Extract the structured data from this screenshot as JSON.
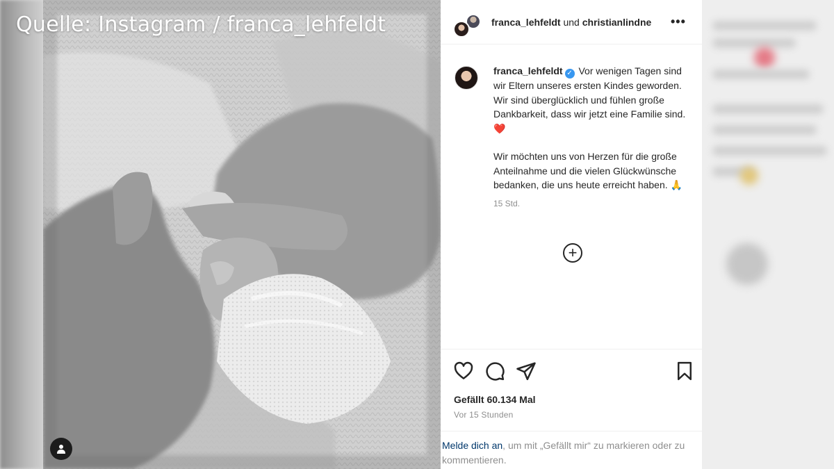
{
  "overlay": {
    "source_caption": "Quelle: Instagram / franca_lehfeldt"
  },
  "post": {
    "header": {
      "author": "franca_lehfeldt",
      "joiner": "und",
      "coauthor": "christianlindne"
    },
    "caption": {
      "username": "franca_lehfeldt",
      "verified": true,
      "paragraph1": "Vor wenigen Tagen sind wir Eltern unseres ersten Kindes geworden. Wir sind überglücklich und fühlen große Dankbarkeit, dass wir jetzt eine Familie sind.",
      "paragraph1_emoji": "❤️",
      "paragraph2": "Wir möchten uns von Herzen für die große Anteilnahme und die vielen Glückwünsche bedanken, die uns heute erreicht haben.",
      "paragraph2_emoji": "🙏",
      "time": "15 Std."
    },
    "likes": "Gefällt 60.134 Mal",
    "posted_ago": "Vor 15 Stunden",
    "login_prompt": {
      "link": "Melde dich an",
      "rest": ", um mit „Gefällt mir“ zu markieren oder zu kommentieren."
    }
  },
  "icons": {
    "more": "more-options-icon",
    "verified": "verified-badge-icon",
    "load_more": "add-circle-icon",
    "like": "heart-icon",
    "comment": "comment-icon",
    "share": "share-icon",
    "save": "bookmark-icon",
    "user_tag": "user-tag-icon"
  },
  "colors": {
    "verified": "#3897f0",
    "link": "#00376b",
    "heart": "#e0245e",
    "muted": "#8e8e8e"
  }
}
